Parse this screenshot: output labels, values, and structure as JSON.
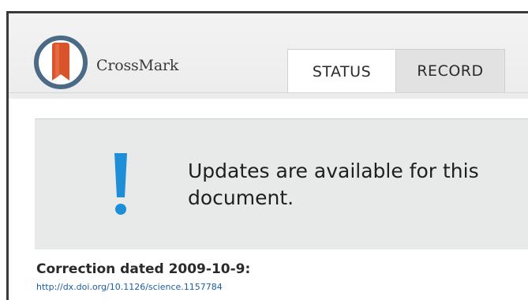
{
  "header": {
    "brand_name": "CrossMark",
    "logo_icon": "crossmark-ribbon-icon",
    "colors": {
      "logo_ring": "#4a6a86",
      "logo_ribbon": "#d9532b"
    }
  },
  "tabs": [
    {
      "label": "STATUS",
      "active": true
    },
    {
      "label": "RECORD",
      "active": false
    }
  ],
  "banner": {
    "icon": "exclamation-icon",
    "icon_color": "#1e8fd6",
    "message": "Updates are available for this document."
  },
  "correction": {
    "label": "Correction dated 2009-10-9:",
    "link_text": "http://dx.doi.org/10.1126/science.1157784"
  }
}
